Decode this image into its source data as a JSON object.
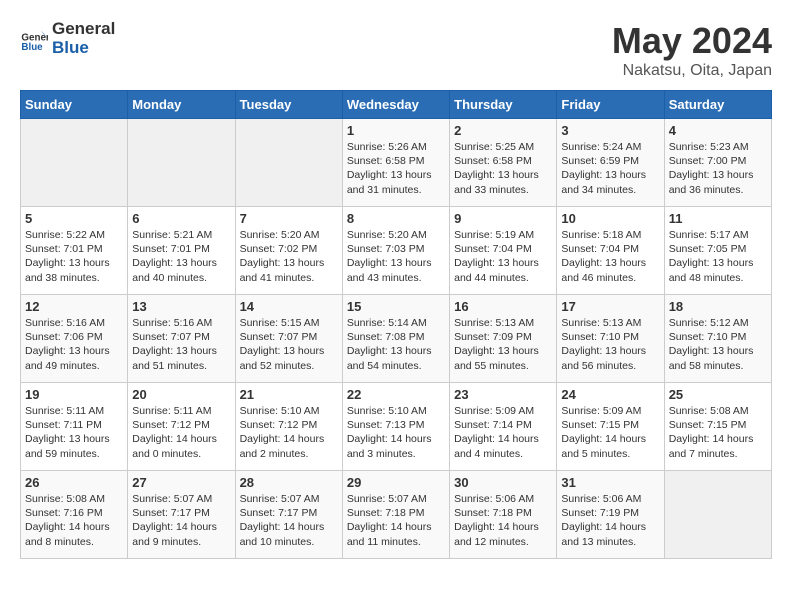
{
  "header": {
    "logo_general": "General",
    "logo_blue": "Blue",
    "title": "May 2024",
    "subtitle": "Nakatsu, Oita, Japan"
  },
  "days_of_week": [
    "Sunday",
    "Monday",
    "Tuesday",
    "Wednesday",
    "Thursday",
    "Friday",
    "Saturday"
  ],
  "weeks": [
    [
      {
        "day": "",
        "content": ""
      },
      {
        "day": "",
        "content": ""
      },
      {
        "day": "",
        "content": ""
      },
      {
        "day": "1",
        "content": "Sunrise: 5:26 AM\nSunset: 6:58 PM\nDaylight: 13 hours and 31 minutes."
      },
      {
        "day": "2",
        "content": "Sunrise: 5:25 AM\nSunset: 6:58 PM\nDaylight: 13 hours and 33 minutes."
      },
      {
        "day": "3",
        "content": "Sunrise: 5:24 AM\nSunset: 6:59 PM\nDaylight: 13 hours and 34 minutes."
      },
      {
        "day": "4",
        "content": "Sunrise: 5:23 AM\nSunset: 7:00 PM\nDaylight: 13 hours and 36 minutes."
      }
    ],
    [
      {
        "day": "5",
        "content": "Sunrise: 5:22 AM\nSunset: 7:01 PM\nDaylight: 13 hours and 38 minutes."
      },
      {
        "day": "6",
        "content": "Sunrise: 5:21 AM\nSunset: 7:01 PM\nDaylight: 13 hours and 40 minutes."
      },
      {
        "day": "7",
        "content": "Sunrise: 5:20 AM\nSunset: 7:02 PM\nDaylight: 13 hours and 41 minutes."
      },
      {
        "day": "8",
        "content": "Sunrise: 5:20 AM\nSunset: 7:03 PM\nDaylight: 13 hours and 43 minutes."
      },
      {
        "day": "9",
        "content": "Sunrise: 5:19 AM\nSunset: 7:04 PM\nDaylight: 13 hours and 44 minutes."
      },
      {
        "day": "10",
        "content": "Sunrise: 5:18 AM\nSunset: 7:04 PM\nDaylight: 13 hours and 46 minutes."
      },
      {
        "day": "11",
        "content": "Sunrise: 5:17 AM\nSunset: 7:05 PM\nDaylight: 13 hours and 48 minutes."
      }
    ],
    [
      {
        "day": "12",
        "content": "Sunrise: 5:16 AM\nSunset: 7:06 PM\nDaylight: 13 hours and 49 minutes."
      },
      {
        "day": "13",
        "content": "Sunrise: 5:16 AM\nSunset: 7:07 PM\nDaylight: 13 hours and 51 minutes."
      },
      {
        "day": "14",
        "content": "Sunrise: 5:15 AM\nSunset: 7:07 PM\nDaylight: 13 hours and 52 minutes."
      },
      {
        "day": "15",
        "content": "Sunrise: 5:14 AM\nSunset: 7:08 PM\nDaylight: 13 hours and 54 minutes."
      },
      {
        "day": "16",
        "content": "Sunrise: 5:13 AM\nSunset: 7:09 PM\nDaylight: 13 hours and 55 minutes."
      },
      {
        "day": "17",
        "content": "Sunrise: 5:13 AM\nSunset: 7:10 PM\nDaylight: 13 hours and 56 minutes."
      },
      {
        "day": "18",
        "content": "Sunrise: 5:12 AM\nSunset: 7:10 PM\nDaylight: 13 hours and 58 minutes."
      }
    ],
    [
      {
        "day": "19",
        "content": "Sunrise: 5:11 AM\nSunset: 7:11 PM\nDaylight: 13 hours and 59 minutes."
      },
      {
        "day": "20",
        "content": "Sunrise: 5:11 AM\nSunset: 7:12 PM\nDaylight: 14 hours and 0 minutes."
      },
      {
        "day": "21",
        "content": "Sunrise: 5:10 AM\nSunset: 7:12 PM\nDaylight: 14 hours and 2 minutes."
      },
      {
        "day": "22",
        "content": "Sunrise: 5:10 AM\nSunset: 7:13 PM\nDaylight: 14 hours and 3 minutes."
      },
      {
        "day": "23",
        "content": "Sunrise: 5:09 AM\nSunset: 7:14 PM\nDaylight: 14 hours and 4 minutes."
      },
      {
        "day": "24",
        "content": "Sunrise: 5:09 AM\nSunset: 7:15 PM\nDaylight: 14 hours and 5 minutes."
      },
      {
        "day": "25",
        "content": "Sunrise: 5:08 AM\nSunset: 7:15 PM\nDaylight: 14 hours and 7 minutes."
      }
    ],
    [
      {
        "day": "26",
        "content": "Sunrise: 5:08 AM\nSunset: 7:16 PM\nDaylight: 14 hours and 8 minutes."
      },
      {
        "day": "27",
        "content": "Sunrise: 5:07 AM\nSunset: 7:17 PM\nDaylight: 14 hours and 9 minutes."
      },
      {
        "day": "28",
        "content": "Sunrise: 5:07 AM\nSunset: 7:17 PM\nDaylight: 14 hours and 10 minutes."
      },
      {
        "day": "29",
        "content": "Sunrise: 5:07 AM\nSunset: 7:18 PM\nDaylight: 14 hours and 11 minutes."
      },
      {
        "day": "30",
        "content": "Sunrise: 5:06 AM\nSunset: 7:18 PM\nDaylight: 14 hours and 12 minutes."
      },
      {
        "day": "31",
        "content": "Sunrise: 5:06 AM\nSunset: 7:19 PM\nDaylight: 14 hours and 13 minutes."
      },
      {
        "day": "",
        "content": ""
      }
    ]
  ]
}
